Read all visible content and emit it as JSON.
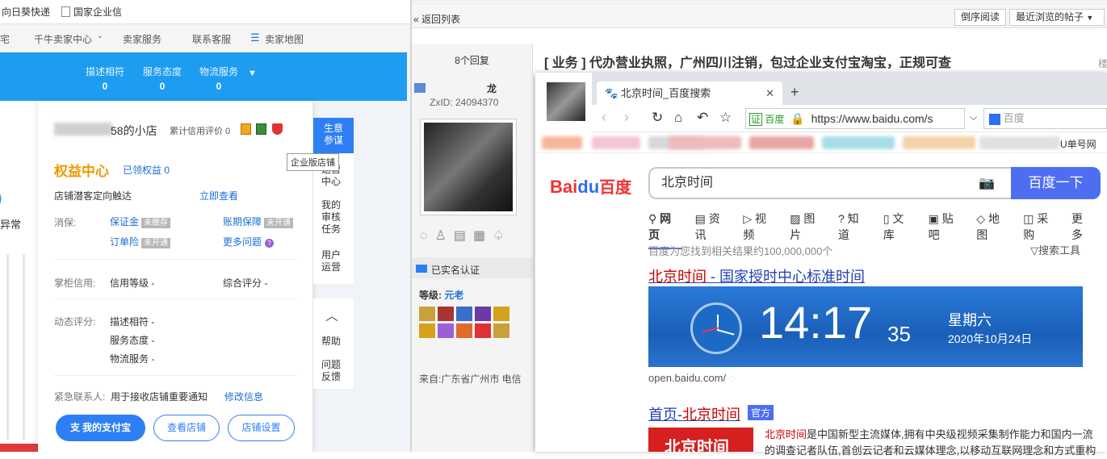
{
  "left": {
    "bookmarks": [
      "向日葵快递",
      "国家企业信"
    ],
    "topnav": [
      "千牛卖家中心",
      "卖家服务",
      "联系客服",
      "卖家地图"
    ],
    "ratings": [
      {
        "label": "描述相符",
        "value": "0"
      },
      {
        "label": "服务态度",
        "value": "0"
      },
      {
        "label": "物流服务",
        "value": "0"
      }
    ],
    "left_fragment": "异常",
    "shop": {
      "name_suffix": "58的小店",
      "credit": "累计信用评价 0",
      "enterprise_tip": "企业版店铺"
    },
    "rights": {
      "title": "权益中心",
      "claimed": "已领权益 0",
      "targeting": "店铺潜客定向触达",
      "view_now": "立即查看"
    },
    "xiaobao": {
      "label": "消保:",
      "items": [
        {
          "name": "保证金",
          "tag": "未缴存"
        },
        {
          "name": "账期保障",
          "tag": "未开通"
        },
        {
          "name": "订单险",
          "tag": "未开通"
        },
        {
          "name": "更多问题",
          "tag": ""
        }
      ]
    },
    "credit": {
      "label": "掌柜信用:",
      "level": "信用等级 -",
      "score": "综合评分 -"
    },
    "dynamic": {
      "label": "动态评分:",
      "items": [
        "描述相符 -",
        "服务态度 -",
        "物流服务 -"
      ]
    },
    "contact": {
      "label": "紧急联系人:",
      "desc": "用于接收店铺重要通知",
      "edit": "修改信息"
    },
    "buttons": [
      "我的支付宝",
      "查看店铺",
      "店铺设置"
    ],
    "sidebar": [
      "生意参谋",
      "运营中心",
      "我的审核任务",
      "用户运营",
      "帮助",
      "问题反馈"
    ]
  },
  "forum": {
    "back": "« 返回列表",
    "sort": "倒序阅读",
    "recent": "最近浏览的帖子",
    "replies": "8个回复",
    "title": "[ 业务 ] 代办营业执照，广州四川注销，包过企业支付宝淘宝，正规可查",
    "user": {
      "name": "龙",
      "zxid": "ZxID:  24094370",
      "verified": "已实名认证",
      "level_label": "等级: ",
      "level": "元老",
      "from": "来自:广东省广州市 电信"
    }
  },
  "browser": {
    "tab_title": "北京时间_百度搜索",
    "cert": "百度",
    "url": "https://www.baidu.com/s",
    "search_engine": "百度",
    "fav_end": "U单号网",
    "logo_text": "百度",
    "query": "北京时间",
    "search_btn": "百度一下",
    "nav": [
      "网页",
      "资讯",
      "视频",
      "图片",
      "知道",
      "文库",
      "贴吧",
      "地图",
      "采购",
      "更多"
    ],
    "result_count": "百度为您找到相关结果约100,000,000个",
    "tools": "搜索工具",
    "r1_title_a": "北京时间",
    "r1_title_b": " - 国家授时中心标准时间",
    "time": "14:17",
    "sec": "35",
    "weekday": "星期六",
    "date": "2020年10月24日",
    "r1_url": "open.baidu.com/",
    "r2_title_a": "首页-",
    "r2_title_b": "北京时间",
    "official": "官方",
    "r2_desc_a": "北京时间",
    "r2_desc_b": "是中国新型主流媒体,拥有中央级视频采集制作能力和国内一流",
    "r2_desc_c": "的调查记者队伍,首创云记者和云媒体理念,以移动互联网理念和方式重构"
  },
  "colors": {
    "blue": "#1e9cf0",
    "baidu_blue": "#4e6ef2",
    "orange": "#f39800",
    "red_link": "#c00"
  }
}
